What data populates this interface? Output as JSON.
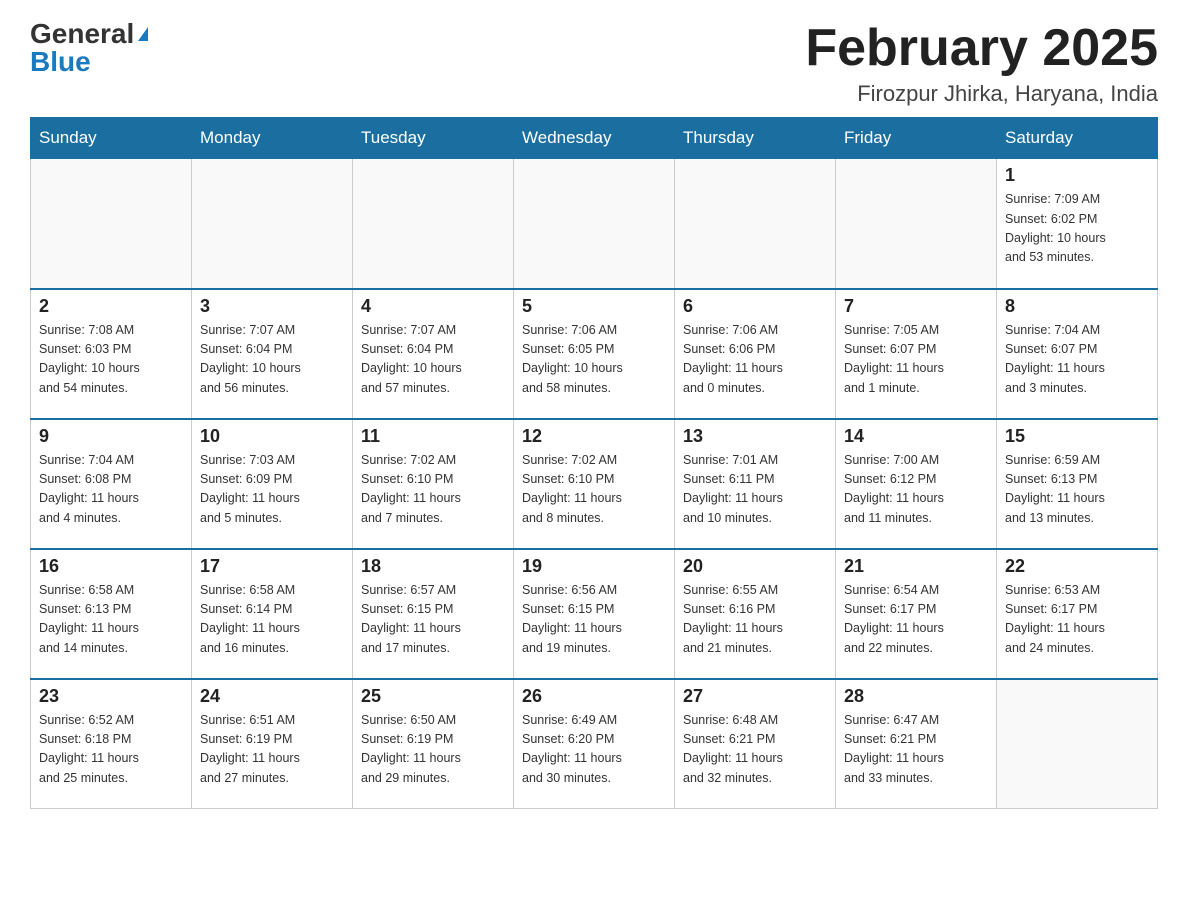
{
  "logo": {
    "general": "General",
    "blue": "Blue"
  },
  "header": {
    "title": "February 2025",
    "subtitle": "Firozpur Jhirka, Haryana, India"
  },
  "weekdays": [
    "Sunday",
    "Monday",
    "Tuesday",
    "Wednesday",
    "Thursday",
    "Friday",
    "Saturday"
  ],
  "weeks": [
    [
      {
        "day": "",
        "info": ""
      },
      {
        "day": "",
        "info": ""
      },
      {
        "day": "",
        "info": ""
      },
      {
        "day": "",
        "info": ""
      },
      {
        "day": "",
        "info": ""
      },
      {
        "day": "",
        "info": ""
      },
      {
        "day": "1",
        "info": "Sunrise: 7:09 AM\nSunset: 6:02 PM\nDaylight: 10 hours\nand 53 minutes."
      }
    ],
    [
      {
        "day": "2",
        "info": "Sunrise: 7:08 AM\nSunset: 6:03 PM\nDaylight: 10 hours\nand 54 minutes."
      },
      {
        "day": "3",
        "info": "Sunrise: 7:07 AM\nSunset: 6:04 PM\nDaylight: 10 hours\nand 56 minutes."
      },
      {
        "day": "4",
        "info": "Sunrise: 7:07 AM\nSunset: 6:04 PM\nDaylight: 10 hours\nand 57 minutes."
      },
      {
        "day": "5",
        "info": "Sunrise: 7:06 AM\nSunset: 6:05 PM\nDaylight: 10 hours\nand 58 minutes."
      },
      {
        "day": "6",
        "info": "Sunrise: 7:06 AM\nSunset: 6:06 PM\nDaylight: 11 hours\nand 0 minutes."
      },
      {
        "day": "7",
        "info": "Sunrise: 7:05 AM\nSunset: 6:07 PM\nDaylight: 11 hours\nand 1 minute."
      },
      {
        "day": "8",
        "info": "Sunrise: 7:04 AM\nSunset: 6:07 PM\nDaylight: 11 hours\nand 3 minutes."
      }
    ],
    [
      {
        "day": "9",
        "info": "Sunrise: 7:04 AM\nSunset: 6:08 PM\nDaylight: 11 hours\nand 4 minutes."
      },
      {
        "day": "10",
        "info": "Sunrise: 7:03 AM\nSunset: 6:09 PM\nDaylight: 11 hours\nand 5 minutes."
      },
      {
        "day": "11",
        "info": "Sunrise: 7:02 AM\nSunset: 6:10 PM\nDaylight: 11 hours\nand 7 minutes."
      },
      {
        "day": "12",
        "info": "Sunrise: 7:02 AM\nSunset: 6:10 PM\nDaylight: 11 hours\nand 8 minutes."
      },
      {
        "day": "13",
        "info": "Sunrise: 7:01 AM\nSunset: 6:11 PM\nDaylight: 11 hours\nand 10 minutes."
      },
      {
        "day": "14",
        "info": "Sunrise: 7:00 AM\nSunset: 6:12 PM\nDaylight: 11 hours\nand 11 minutes."
      },
      {
        "day": "15",
        "info": "Sunrise: 6:59 AM\nSunset: 6:13 PM\nDaylight: 11 hours\nand 13 minutes."
      }
    ],
    [
      {
        "day": "16",
        "info": "Sunrise: 6:58 AM\nSunset: 6:13 PM\nDaylight: 11 hours\nand 14 minutes."
      },
      {
        "day": "17",
        "info": "Sunrise: 6:58 AM\nSunset: 6:14 PM\nDaylight: 11 hours\nand 16 minutes."
      },
      {
        "day": "18",
        "info": "Sunrise: 6:57 AM\nSunset: 6:15 PM\nDaylight: 11 hours\nand 17 minutes."
      },
      {
        "day": "19",
        "info": "Sunrise: 6:56 AM\nSunset: 6:15 PM\nDaylight: 11 hours\nand 19 minutes."
      },
      {
        "day": "20",
        "info": "Sunrise: 6:55 AM\nSunset: 6:16 PM\nDaylight: 11 hours\nand 21 minutes."
      },
      {
        "day": "21",
        "info": "Sunrise: 6:54 AM\nSunset: 6:17 PM\nDaylight: 11 hours\nand 22 minutes."
      },
      {
        "day": "22",
        "info": "Sunrise: 6:53 AM\nSunset: 6:17 PM\nDaylight: 11 hours\nand 24 minutes."
      }
    ],
    [
      {
        "day": "23",
        "info": "Sunrise: 6:52 AM\nSunset: 6:18 PM\nDaylight: 11 hours\nand 25 minutes."
      },
      {
        "day": "24",
        "info": "Sunrise: 6:51 AM\nSunset: 6:19 PM\nDaylight: 11 hours\nand 27 minutes."
      },
      {
        "day": "25",
        "info": "Sunrise: 6:50 AM\nSunset: 6:19 PM\nDaylight: 11 hours\nand 29 minutes."
      },
      {
        "day": "26",
        "info": "Sunrise: 6:49 AM\nSunset: 6:20 PM\nDaylight: 11 hours\nand 30 minutes."
      },
      {
        "day": "27",
        "info": "Sunrise: 6:48 AM\nSunset: 6:21 PM\nDaylight: 11 hours\nand 32 minutes."
      },
      {
        "day": "28",
        "info": "Sunrise: 6:47 AM\nSunset: 6:21 PM\nDaylight: 11 hours\nand 33 minutes."
      },
      {
        "day": "",
        "info": ""
      }
    ]
  ]
}
